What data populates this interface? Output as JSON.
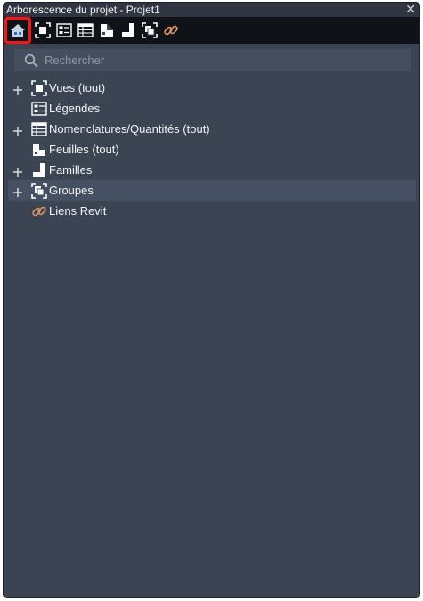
{
  "window": {
    "title": "Arborescence du projet - Projet1",
    "close_glyph": "✕"
  },
  "toolbar": {
    "buttons": [
      {
        "icon": "home-icon",
        "selected": true
      },
      {
        "icon": "views-icon"
      },
      {
        "icon": "legends-icon"
      },
      {
        "icon": "schedules-icon"
      },
      {
        "icon": "sheets-icon"
      },
      {
        "icon": "families-icon"
      },
      {
        "icon": "groups-icon"
      },
      {
        "icon": "revit-links-icon"
      }
    ]
  },
  "search": {
    "placeholder": "Rechercher",
    "value": ""
  },
  "tree": {
    "items": [
      {
        "label": "Vues (tout)",
        "icon": "views-icon",
        "expandable": true
      },
      {
        "label": "Légendes",
        "icon": "legends-icon",
        "expandable": false
      },
      {
        "label": "Nomenclatures/Quantités (tout)",
        "icon": "schedules-icon",
        "expandable": true
      },
      {
        "label": "Feuilles (tout)",
        "icon": "sheets-icon",
        "expandable": false
      },
      {
        "label": "Familles",
        "icon": "families-icon",
        "expandable": true
      },
      {
        "label": "Groupes",
        "icon": "groups-icon",
        "expandable": true,
        "selected": true
      },
      {
        "label": "Liens Revit",
        "icon": "revit-links-icon",
        "expandable": false
      }
    ]
  },
  "colors": {
    "panel_bg": "#3b4453",
    "toolbar_bg": "#0f1216",
    "highlight": "#ff1111",
    "link_icon": "#e0905c"
  }
}
